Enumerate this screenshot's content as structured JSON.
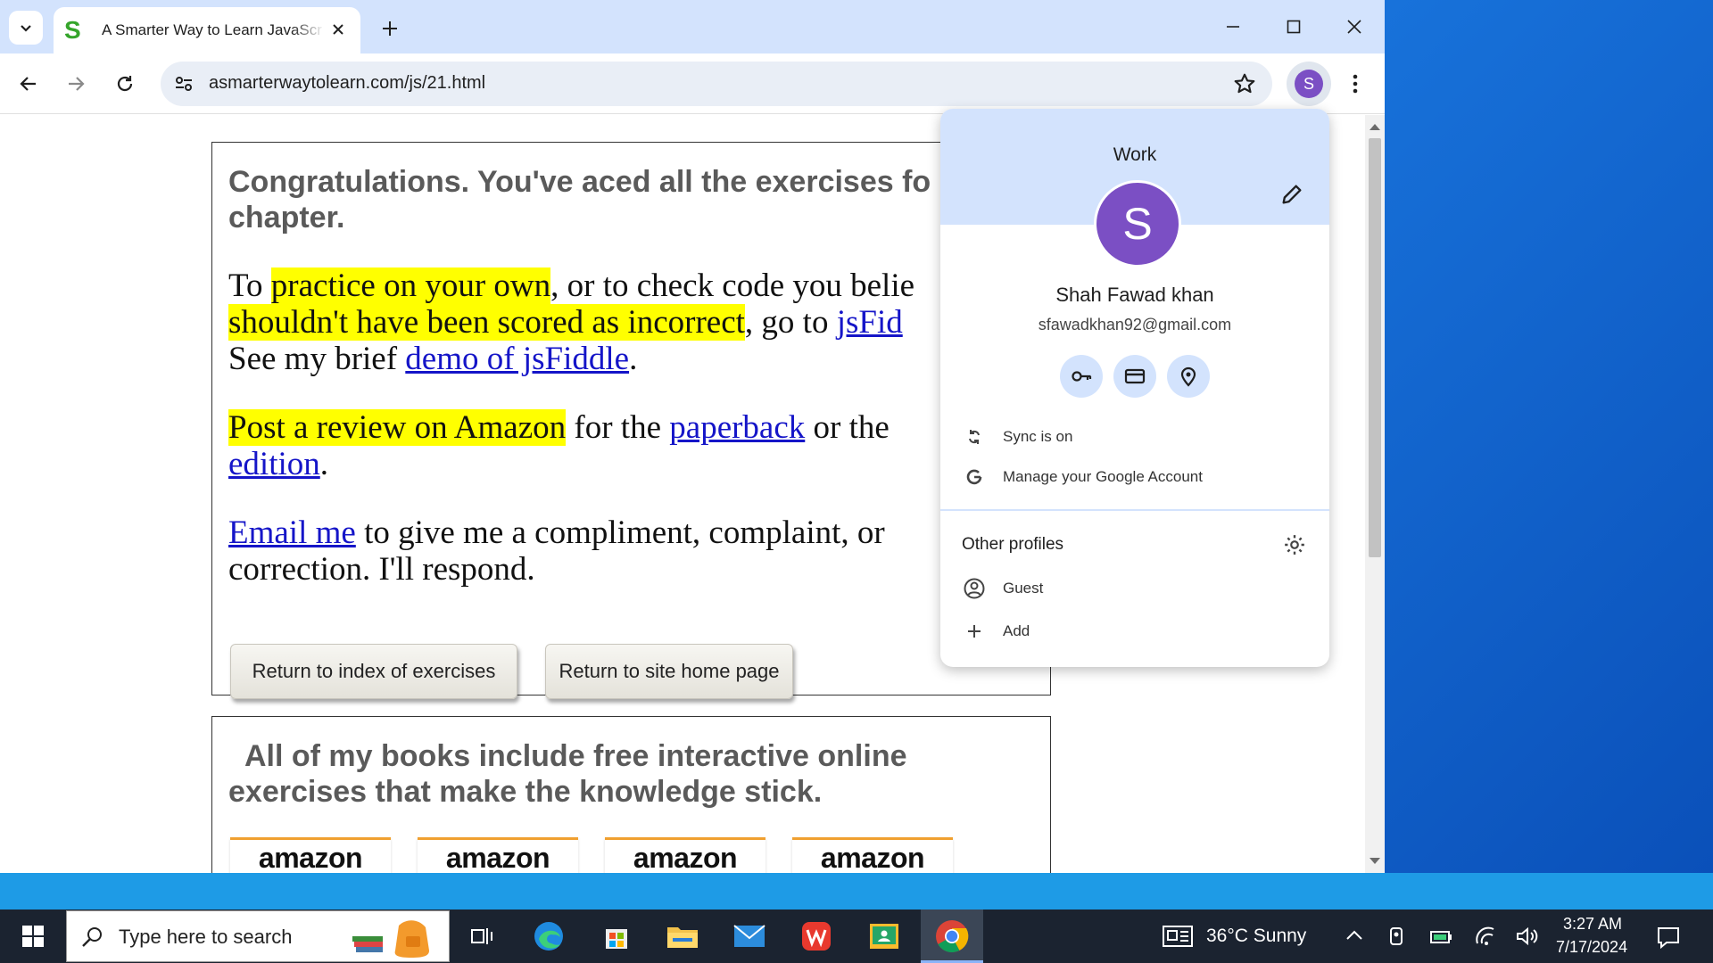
{
  "browser": {
    "tab_title": "A Smarter Way to Learn JavaScr",
    "tab_favicon_letter": "S",
    "url": "asmarterwaytolearn.com/js/21.html",
    "avatar_letter": "S"
  },
  "page": {
    "heading_line1": "Congratulations. You've aced all the exercises fo",
    "heading_line2": "chapter.",
    "p1_a": "To ",
    "p1_hl1": "practice on your own",
    "p1_b": ", or to check code you belie",
    "p1_hl2": "shouldn't have been scored as incorrect",
    "p1_c": ", go to ",
    "p1_link1": "jsFid",
    "p1_d": "See my brief ",
    "p1_link2": "demo of jsFiddle",
    "p1_e": ".",
    "p2_hl": "Post a review on Amazon",
    "p2_a": " for the ",
    "p2_link1": "paperback",
    "p2_b": " or the ",
    "p2_link2": "edition",
    "p2_c": ".",
    "p3_link": "Email me",
    "p3_a": " to give me a compliment, complaint, or",
    "p3_b": "correction. I'll respond.",
    "btn_index": "Return to index of exercises",
    "btn_home": "Return to site home page",
    "books_line1": "All of my books include free interactive online",
    "books_line2": "exercises that make the knowledge stick.",
    "amazon_logos": [
      "amazon",
      "amazon",
      "amazon",
      "amazon"
    ]
  },
  "profile": {
    "profile_label": "Work",
    "avatar_letter": "S",
    "name": "Shah Fawad khan",
    "email": "sfawadkhan92@gmail.com",
    "sync_label": "Sync is on",
    "manage_label": "Manage your Google Account",
    "other_profiles_label": "Other profiles",
    "guest_label": "Guest",
    "add_label": "Add"
  },
  "taskbar": {
    "search_placeholder": "Type here to search",
    "weather": "36°C  Sunny",
    "time": "3:27 AM",
    "date": "7/17/2024"
  }
}
